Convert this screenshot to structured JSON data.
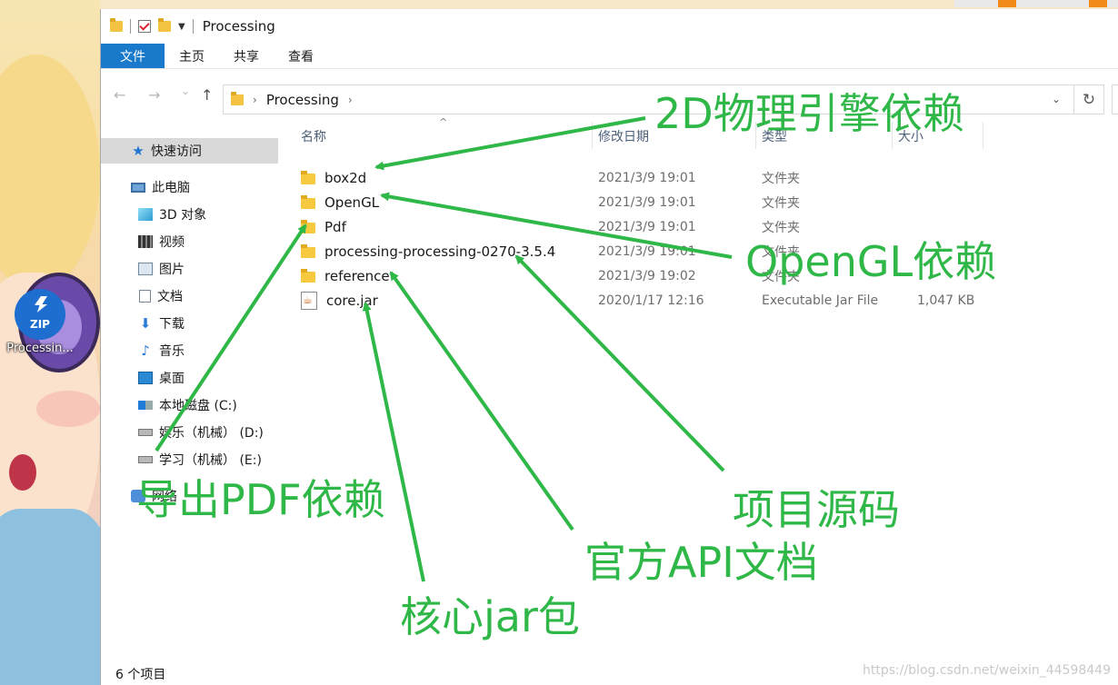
{
  "window": {
    "title": "Processing"
  },
  "ribbon": {
    "tabs": [
      "文件",
      "主页",
      "共享",
      "查看"
    ]
  },
  "address": {
    "path": "Processing",
    "refresh_glyph": "↻"
  },
  "nav": {
    "back": "←",
    "forward": "→",
    "recent": "⌄",
    "up": "↑"
  },
  "sidebar": {
    "items": [
      {
        "label": "快速访问",
        "icon": "star-icon"
      },
      {
        "label": "此电脑",
        "icon": "computer-icon"
      },
      {
        "label": "3D 对象",
        "icon": "3d-objects-icon"
      },
      {
        "label": "视频",
        "icon": "video-icon"
      },
      {
        "label": "图片",
        "icon": "pictures-icon"
      },
      {
        "label": "文档",
        "icon": "documents-icon"
      },
      {
        "label": "下载",
        "icon": "download-icon"
      },
      {
        "label": "音乐",
        "icon": "music-icon"
      },
      {
        "label": "桌面",
        "icon": "desktop-icon"
      },
      {
        "label": "本地磁盘 (C:)",
        "icon": "drive-c-icon"
      },
      {
        "label": "娱乐（机械） (D:)",
        "icon": "drive-d-icon"
      },
      {
        "label": "学习（机械） (E:)",
        "icon": "drive-e-icon"
      },
      {
        "label": "网络",
        "icon": "network-icon"
      }
    ]
  },
  "columns": {
    "name": "名称",
    "modified": "修改日期",
    "type": "类型",
    "size": "大小"
  },
  "files": [
    {
      "name": "box2d",
      "modified": "2021/3/9 19:01",
      "type": "文件夹",
      "size": "",
      "icon": "folder-icon"
    },
    {
      "name": "OpenGL",
      "modified": "2021/3/9 19:01",
      "type": "文件夹",
      "size": "",
      "icon": "folder-icon"
    },
    {
      "name": "Pdf",
      "modified": "2021/3/9 19:01",
      "type": "文件夹",
      "size": "",
      "icon": "folder-icon"
    },
    {
      "name": "processing-processing-0270-3.5.4",
      "modified": "2021/3/9 19:01",
      "type": "文件夹",
      "size": "",
      "icon": "folder-icon"
    },
    {
      "name": "reference",
      "modified": "2021/3/9 19:02",
      "type": "文件夹",
      "size": "",
      "icon": "folder-icon"
    },
    {
      "name": "core.jar",
      "modified": "2020/1/17 12:16",
      "type": "Executable Jar File",
      "size": "1,047 KB",
      "icon": "jar-file-icon"
    }
  ],
  "status": {
    "count": "6 个项目"
  },
  "desktop": {
    "icon_label": "Processin...",
    "icon_badge": "ZIP"
  },
  "annotations": {
    "box2d": "2D物理引擎依赖",
    "opengl": "OpenGL依赖",
    "pdf": "导出PDF依赖",
    "source": "项目源码",
    "reference": "官方API文档",
    "core": "核心jar包",
    "color": "#2fb848"
  },
  "watermark": "https://blog.csdn.net/weixin_44598449"
}
